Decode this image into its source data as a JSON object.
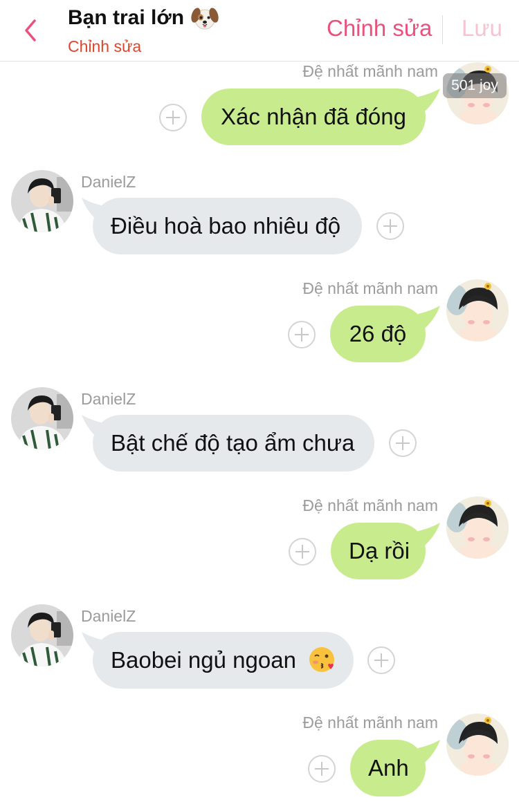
{
  "header": {
    "title": "Bạn trai lớn",
    "title_icon": "dog-face-icon",
    "subtitle": "Chỉnh sửa",
    "edit_label": "Chỉnh sửa",
    "save_label": "Lưu",
    "back_icon": "chevron-left-icon"
  },
  "colors": {
    "accent_pink": "#e8527c",
    "accent_pink_disabled": "#f6c3d2",
    "subtitle_red": "#e0442c",
    "bubble_sent": "#c8ec8d",
    "bubble_received": "#e6e9ec"
  },
  "watermark": "501 joy",
  "messages": [
    {
      "side": "right",
      "sender": "Đệ nhất mãnh nam",
      "text": "Xác nhận đã đóng"
    },
    {
      "side": "left",
      "sender": "DanielZ",
      "text": "Điều hoà bao nhiêu độ"
    },
    {
      "side": "right",
      "sender": "Đệ nhất mãnh nam",
      "text": "26 độ"
    },
    {
      "side": "left",
      "sender": "DanielZ",
      "text": "Bật chế độ tạo ẩm chưa"
    },
    {
      "side": "right",
      "sender": "Đệ nhất mãnh nam",
      "text": "Dạ rồi"
    },
    {
      "side": "left",
      "sender": "DanielZ",
      "text": "Baobei ngủ ngoan",
      "emoji": "kissing-face-icon"
    },
    {
      "side": "right",
      "sender": "Đệ nhất mãnh nam",
      "text": "Anh"
    }
  ]
}
